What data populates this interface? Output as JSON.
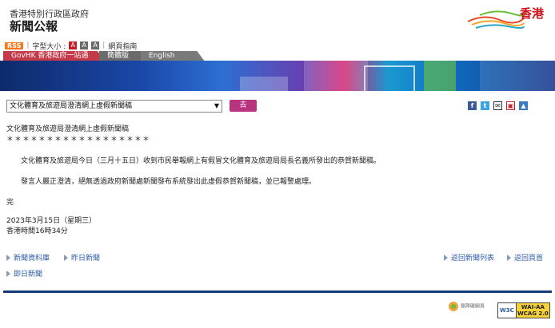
{
  "header": {
    "gov_name": "香港特別行政區政府",
    "site_title": "新聞公報",
    "logo_text": "香港"
  },
  "toolbar": {
    "rss": "RSS",
    "font_size_label": "字型大小 :",
    "font_sizes": [
      "A",
      "A",
      "A"
    ],
    "guide": "網頁指南"
  },
  "tabs": [
    "GovHK 香港政府一站通",
    "簡體版",
    "English"
  ],
  "controls": {
    "selected_option": "文化體育及旅遊局澄清網上虛假新聞稿",
    "go_button": "去"
  },
  "share_icons": [
    "facebook-icon",
    "twitter-icon",
    "email-icon",
    "print-icon",
    "share-icon"
  ],
  "article": {
    "title": "文化體育及旅遊局澄清網上虛假新聞稿",
    "stars": "＊＊＊＊＊＊＊＊＊＊＊＊＊＊＊＊＊＊",
    "para1": "文化體育及旅遊局今日（三月十五日）收到市民舉報網上有假冒文化體育及旅遊局局長名義所發出的恭賀新聞稿。",
    "para2": "發言人嚴正澄清，絕無透過政府新聞處新聞發布系統發出此虛假恭賀新聞稿，並已報警處理。",
    "end": "完",
    "date": "2023年3月15日（星期三）",
    "time": "香港時間16時34分"
  },
  "links": {
    "archive": "新聞資料庫",
    "yesterday": "昨日新聞",
    "back_list": "返回新聞列表",
    "back_top": "返回頁首",
    "today": "即日新聞"
  },
  "footer": {
    "badge1": "無障礙網頁",
    "w3c": "W3C",
    "wcag_line1": "WAI-AA",
    "wcag_line2": "WCAG 2.0"
  }
}
